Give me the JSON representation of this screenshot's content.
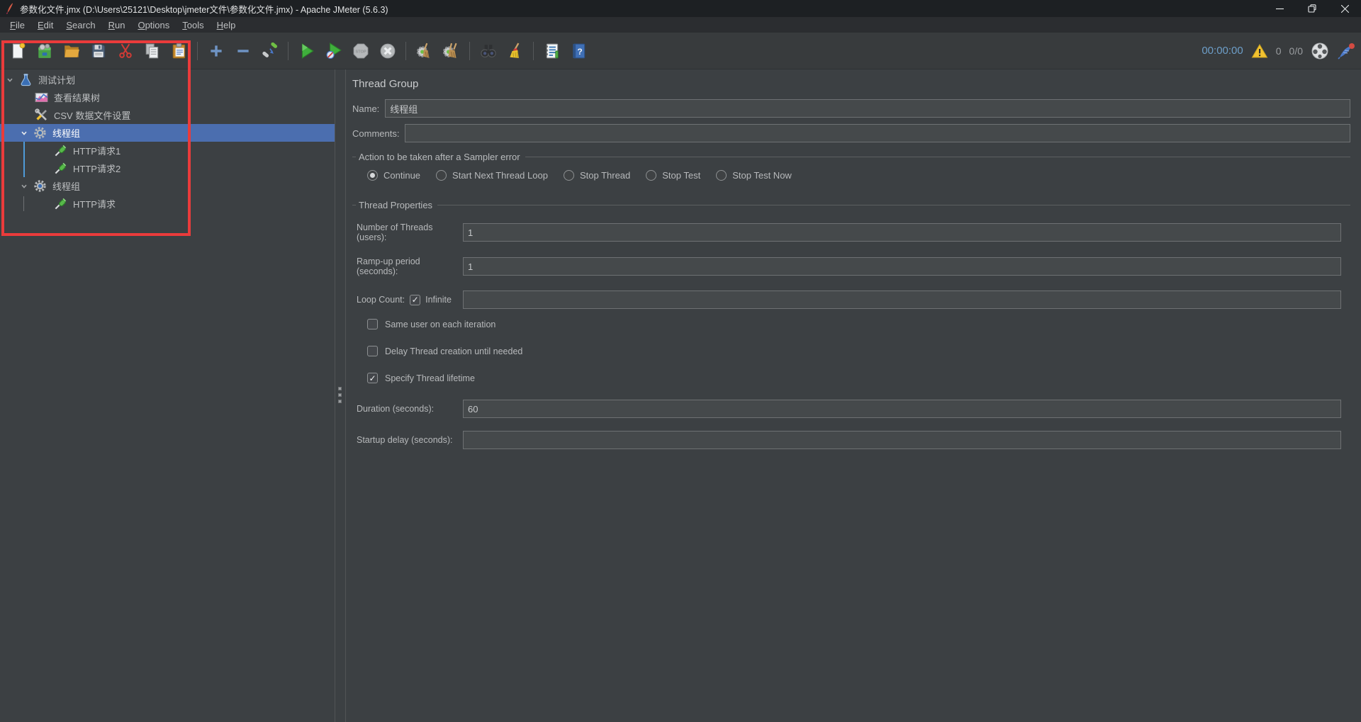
{
  "window": {
    "title": "参数化文件.jmx (D:\\Users\\25121\\Desktop\\jmeter文件\\参数化文件.jmx) - Apache JMeter (5.6.3)"
  },
  "menu": {
    "items": [
      "File",
      "Edit",
      "Search",
      "Run",
      "Options",
      "Tools",
      "Help"
    ]
  },
  "toolbar": {
    "buttons": [
      "new",
      "templates",
      "open",
      "save",
      "cut",
      "copy",
      "paste",
      "expand-all",
      "collapse-all",
      "toggle",
      "start",
      "start-no-pauses",
      "stop",
      "shutdown",
      "clear",
      "clear-all",
      "search",
      "clear-search",
      "function-helper",
      "help"
    ],
    "status": {
      "elapsed": "00:00:00",
      "warning_count": "0",
      "active_threads": "0/0"
    }
  },
  "annotation": {
    "type": "red-box",
    "color": "#ea3b3b"
  },
  "tree": {
    "items": [
      {
        "label": "测试计划",
        "icon": "test-plan",
        "level": 0,
        "expanded": true,
        "selected": false
      },
      {
        "label": "查看结果树",
        "icon": "view-results-tree",
        "level": 1,
        "expanded": false,
        "selected": false
      },
      {
        "label": "CSV 数据文件设置",
        "icon": "csv-data-set-config",
        "level": 1,
        "expanded": false,
        "selected": false
      },
      {
        "label": "线程组",
        "icon": "thread-group",
        "level": 1,
        "expanded": true,
        "selected": true
      },
      {
        "label": "HTTP请求1",
        "icon": "http-request",
        "level": 2,
        "expanded": false,
        "selected": false
      },
      {
        "label": "HTTP请求2",
        "icon": "http-request",
        "level": 2,
        "expanded": false,
        "selected": false
      },
      {
        "label": "线程组",
        "icon": "thread-group",
        "level": 1,
        "expanded": true,
        "selected": false
      },
      {
        "label": "HTTP请求",
        "icon": "http-request",
        "level": 2,
        "expanded": false,
        "selected": false
      }
    ]
  },
  "main": {
    "title": "Thread Group",
    "name": {
      "label": "Name:",
      "value": "线程组"
    },
    "comments": {
      "label": "Comments:",
      "value": ""
    },
    "sampler_error": {
      "title": "Action to be taken after a Sampler error",
      "options": [
        {
          "label": "Continue",
          "selected": true
        },
        {
          "label": "Start Next Thread Loop",
          "selected": false
        },
        {
          "label": "Stop Thread",
          "selected": false
        },
        {
          "label": "Stop Test",
          "selected": false
        },
        {
          "label": "Stop Test Now",
          "selected": false
        }
      ]
    },
    "thread_properties": {
      "title": "Thread Properties",
      "num_threads": {
        "label": "Number of Threads (users):",
        "value": "1"
      },
      "ramp_up": {
        "label": "Ramp-up period (seconds):",
        "value": "1"
      },
      "loop_count": {
        "label": "Loop Count:",
        "infinite_label": "Infinite",
        "infinite_checked": true,
        "value": ""
      },
      "checkboxes": [
        {
          "label": "Same user on each iteration",
          "checked": false
        },
        {
          "label": "Delay Thread creation until needed",
          "checked": false
        },
        {
          "label": "Specify Thread lifetime",
          "checked": true
        }
      ],
      "duration": {
        "label": "Duration (seconds):",
        "value": "60"
      },
      "startup_delay": {
        "label": "Startup delay (seconds):",
        "value": ""
      }
    }
  }
}
